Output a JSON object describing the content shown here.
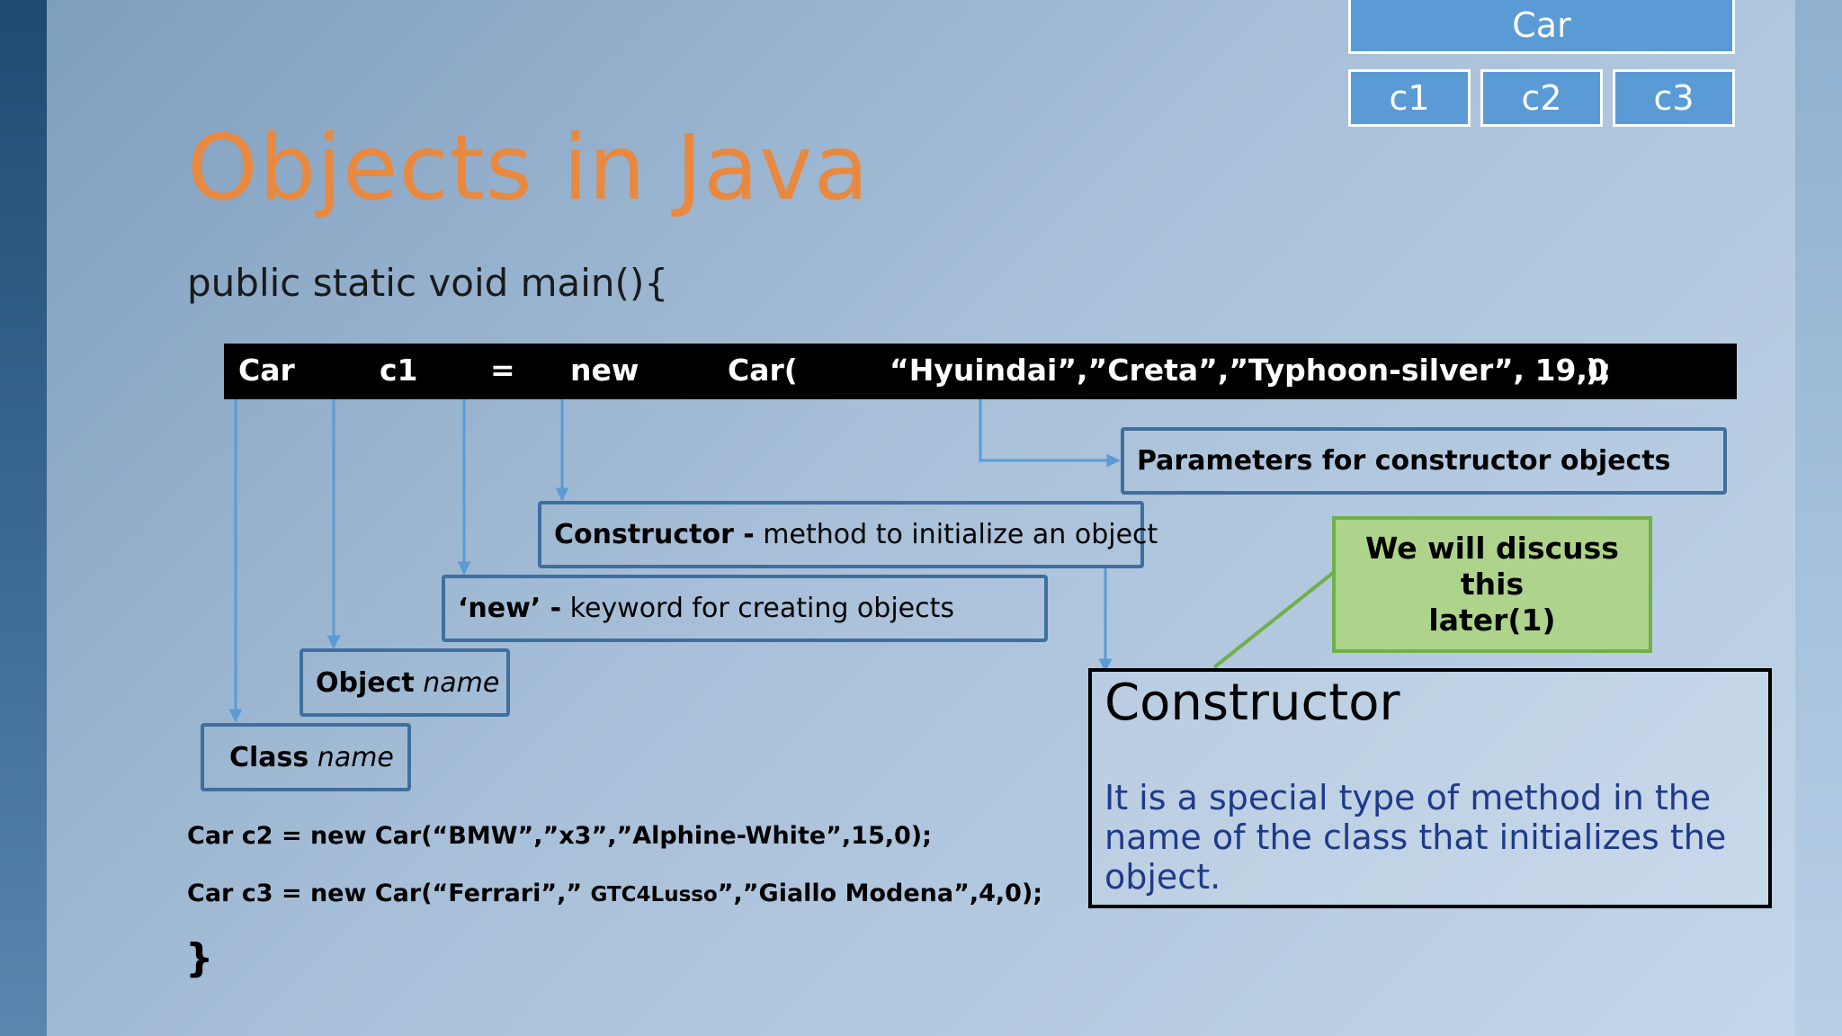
{
  "slide": {
    "title": "Objects in Java",
    "main_signature": "public static void main(){",
    "closing_brace": "}"
  },
  "hierarchy": {
    "class_label": "Car",
    "objects": [
      "c1",
      "c2",
      "c3"
    ]
  },
  "code_statement": {
    "tokens": {
      "class": "Car",
      "object": "c1",
      "equals": "=",
      "new": "new",
      "constructor": "Car(",
      "params": "“Hyuindai”,”Creta”,”Typhoon-silver”, 19,0",
      "end": ");"
    }
  },
  "labels": {
    "params": "Parameters for constructor objects",
    "constructor_bold": "Constructor -",
    "constructor_rest": " method to initialize an object",
    "new_bold": "‘new’ -",
    "new_rest": " keyword for creating objects",
    "object_bold": "Object",
    "object_rest": " name",
    "class_bold": "Class",
    "class_rest": " name"
  },
  "callout": {
    "line1": "We will discuss this",
    "line2": "later(1)"
  },
  "definition": {
    "title": "Constructor",
    "text": "It is a special type of method in the name of the class that initializes the object."
  },
  "more_code": {
    "line_c2": "Car c2 = new Car(“BMW”,”x3”,”Alphine-White”,15,0);",
    "line_c3_a": "Car c3 = new Car(“Ferrari”,” ",
    "line_c3_b": "GTC4Lusso",
    "line_c3_c": "”,”Giallo Modena”,4,0);"
  },
  "colors": {
    "title": "#e8893f",
    "header_box": "#5b9bd5",
    "label_border": "#3e6f9f",
    "arrow": "#5b9bd5",
    "callout_fill": "#aed48c",
    "callout_border": "#6fb04a",
    "definition_text": "#1f3a8a"
  }
}
